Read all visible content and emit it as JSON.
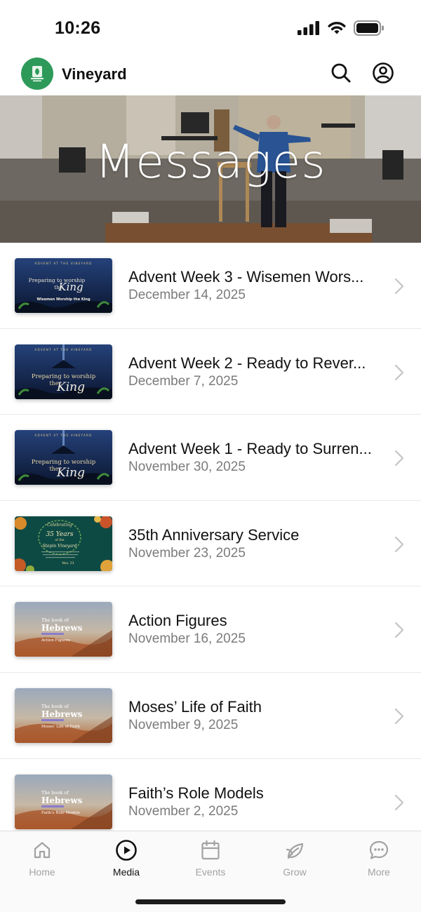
{
  "status": {
    "time": "10:26"
  },
  "app": {
    "title": "Vineyard",
    "logo_icon": "vineyard-logo-icon"
  },
  "header": {
    "search_icon": "search-icon",
    "profile_icon": "user-circle-icon"
  },
  "banner": {
    "title": "Messages"
  },
  "messages": [
    {
      "title": "Advent Week 3 - Wisemen Wors...",
      "date": "December 14, 2025",
      "thumb": {
        "top": "ADVENT AT THE VINEYARD",
        "line1": "Preparing to worship",
        "line2": "the",
        "script": "King",
        "sub": "Wisemen Worship the King"
      }
    },
    {
      "title": "Advent Week 2 - Ready to Rever...",
      "date": "December 7, 2025",
      "thumb": {
        "top": "ADVENT AT THE VINEYARD",
        "line1": "Preparing to worship",
        "line2": "the",
        "script": "King"
      }
    },
    {
      "title": "Advent Week 1 - Ready to Surren...",
      "date": "November 30, 2025",
      "thumb": {
        "top": "ADVENT AT THE VINEYARD",
        "line1": "Preparing to worship",
        "line2": "the",
        "script": "King"
      }
    },
    {
      "title": "35th Anniversary Service",
      "date": "November 23, 2025",
      "thumb": {
        "line1": "Celebrating",
        "line2": "35 Years",
        "line3": "of the",
        "line4": "Stepin Vineyard",
        "date": "Nov. 23"
      }
    },
    {
      "title": "Action Figures",
      "date": "November 16, 2025",
      "thumb": {
        "line1": "The book of",
        "line2": "Hebrews",
        "sub": "Action Figures"
      }
    },
    {
      "title": "Moses’ Life of Faith",
      "date": "November 9, 2025",
      "thumb": {
        "line1": "The book of",
        "line2": "Hebrews",
        "sub": "Moses' Life of Faith"
      }
    },
    {
      "title": "Faith’s Role Models",
      "date": "November 2, 2025",
      "thumb": {
        "line1": "The book of",
        "line2": "Hebrews",
        "sub": "Faith's Role Models"
      }
    }
  ],
  "tabs": [
    {
      "label": "Home",
      "icon": "home-icon",
      "active": false
    },
    {
      "label": "Media",
      "icon": "play-circle-icon",
      "active": true
    },
    {
      "label": "Events",
      "icon": "calendar-icon",
      "active": false
    },
    {
      "label": "Grow",
      "icon": "leaf-icon",
      "active": false
    },
    {
      "label": "More",
      "icon": "chat-bubble-icon",
      "active": false
    }
  ],
  "colors": {
    "accent_active": "#111111",
    "inactive": "#a2a2a2",
    "logo_green": "#2e9a5a",
    "advent_navy": "#0f1f3d",
    "anniversary_teal": "#0e4a44"
  }
}
